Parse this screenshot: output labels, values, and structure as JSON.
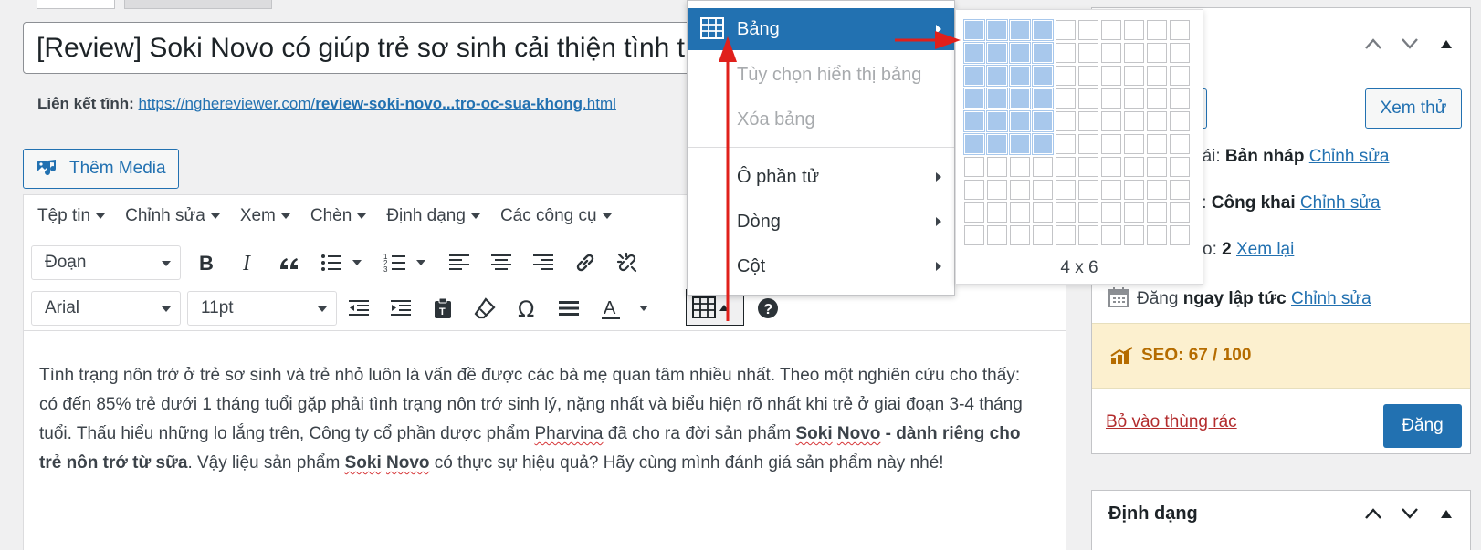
{
  "post": {
    "title": "[Review] Soki Novo có giúp trẻ sơ sinh cải thiện tình trạng nôn trớ sữa không",
    "permalink_label": "Liên kết tĩnh:",
    "permalink_base": "https://nghereviewer.com/",
    "permalink_slug": "review-soki-novo...tro-oc-sua-khong",
    "permalink_ext": ".html"
  },
  "media_button": "Thêm Media",
  "menubar": [
    "Tệp tin",
    "Chỉnh sửa",
    "Xem",
    "Chèn",
    "Định dạng",
    "Các công cụ"
  ],
  "toolbar": {
    "paragraph_select": "Đoạn",
    "font_select": "Arial",
    "size_select": "11pt"
  },
  "table_menu": {
    "items": [
      {
        "label": "Bảng",
        "state": "active",
        "submenu": true
      },
      {
        "label": "Tùy chọn hiển thị bảng",
        "state": "disabled"
      },
      {
        "label": "Xóa bảng",
        "state": "disabled"
      },
      {
        "label": "Ô phần tử",
        "state": "normal",
        "submenu": true
      },
      {
        "label": "Dòng",
        "state": "normal",
        "submenu": true
      },
      {
        "label": "Cột",
        "state": "normal",
        "submenu": true
      }
    ]
  },
  "grid_picker": {
    "rows": 10,
    "cols": 10,
    "selected_cols": 4,
    "selected_rows": 6,
    "label": "4 x 6"
  },
  "content": {
    "p1": "Tình trạng nôn trớ ở trẻ sơ sinh và trẻ nhỏ luôn là vấn đề được các bà mẹ quan tâm nhiều nhất. Theo một nghiên cứu cho thấy: có đến 85% trẻ dưới 1 tháng tuổi gặp phải tình trạng nôn trớ sinh lý, nặng nhất và biểu hiện rõ nhất khi trẻ ở giai đoạn 3-4 tháng tuổi. Thấu hiểu những lo lắng trên, Công ty cổ phần dược phẩm ",
    "brand": "Pharvina",
    "p2": " đã cho ra đời sản phẩm ",
    "bold1_a": "Soki",
    "bold1_sp": " ",
    "bold1_b": "Novo",
    "bold1_rest": " - dành riêng cho trẻ nôn trớ từ sữa",
    "p3": ". Vậy liệu sản phẩm ",
    "bold2_a": "Soki",
    "bold2_sp": " ",
    "bold2_b": "Novo",
    "p4": " có thực sự hiệu quả? Hãy cùng mình đánh giá sản phẩm này nhé!"
  },
  "sidebar": {
    "preview_button": "Xem thử",
    "status_prefix": "hái: ",
    "status_value": "Bản nháp",
    "visibility_prefix": "ị: ",
    "visibility_value": "Công khai",
    "revisions_prefix": "o: ",
    "revisions_value": "2",
    "revisions_link": "Xem lại",
    "edit_link": "Chỉnh sửa",
    "schedule_text": "Đăng ",
    "schedule_bold": "ngay lập tức",
    "seo": "SEO: 67 / 100",
    "trash": "Bỏ vào thùng rác",
    "publish": "Đăng",
    "format_title": "Định dạng"
  },
  "colors": {
    "accent": "#2271b1",
    "grid_selected": "#a8c8ec",
    "seo_bg": "#fcf0cf",
    "arrow": "#e0201b"
  }
}
